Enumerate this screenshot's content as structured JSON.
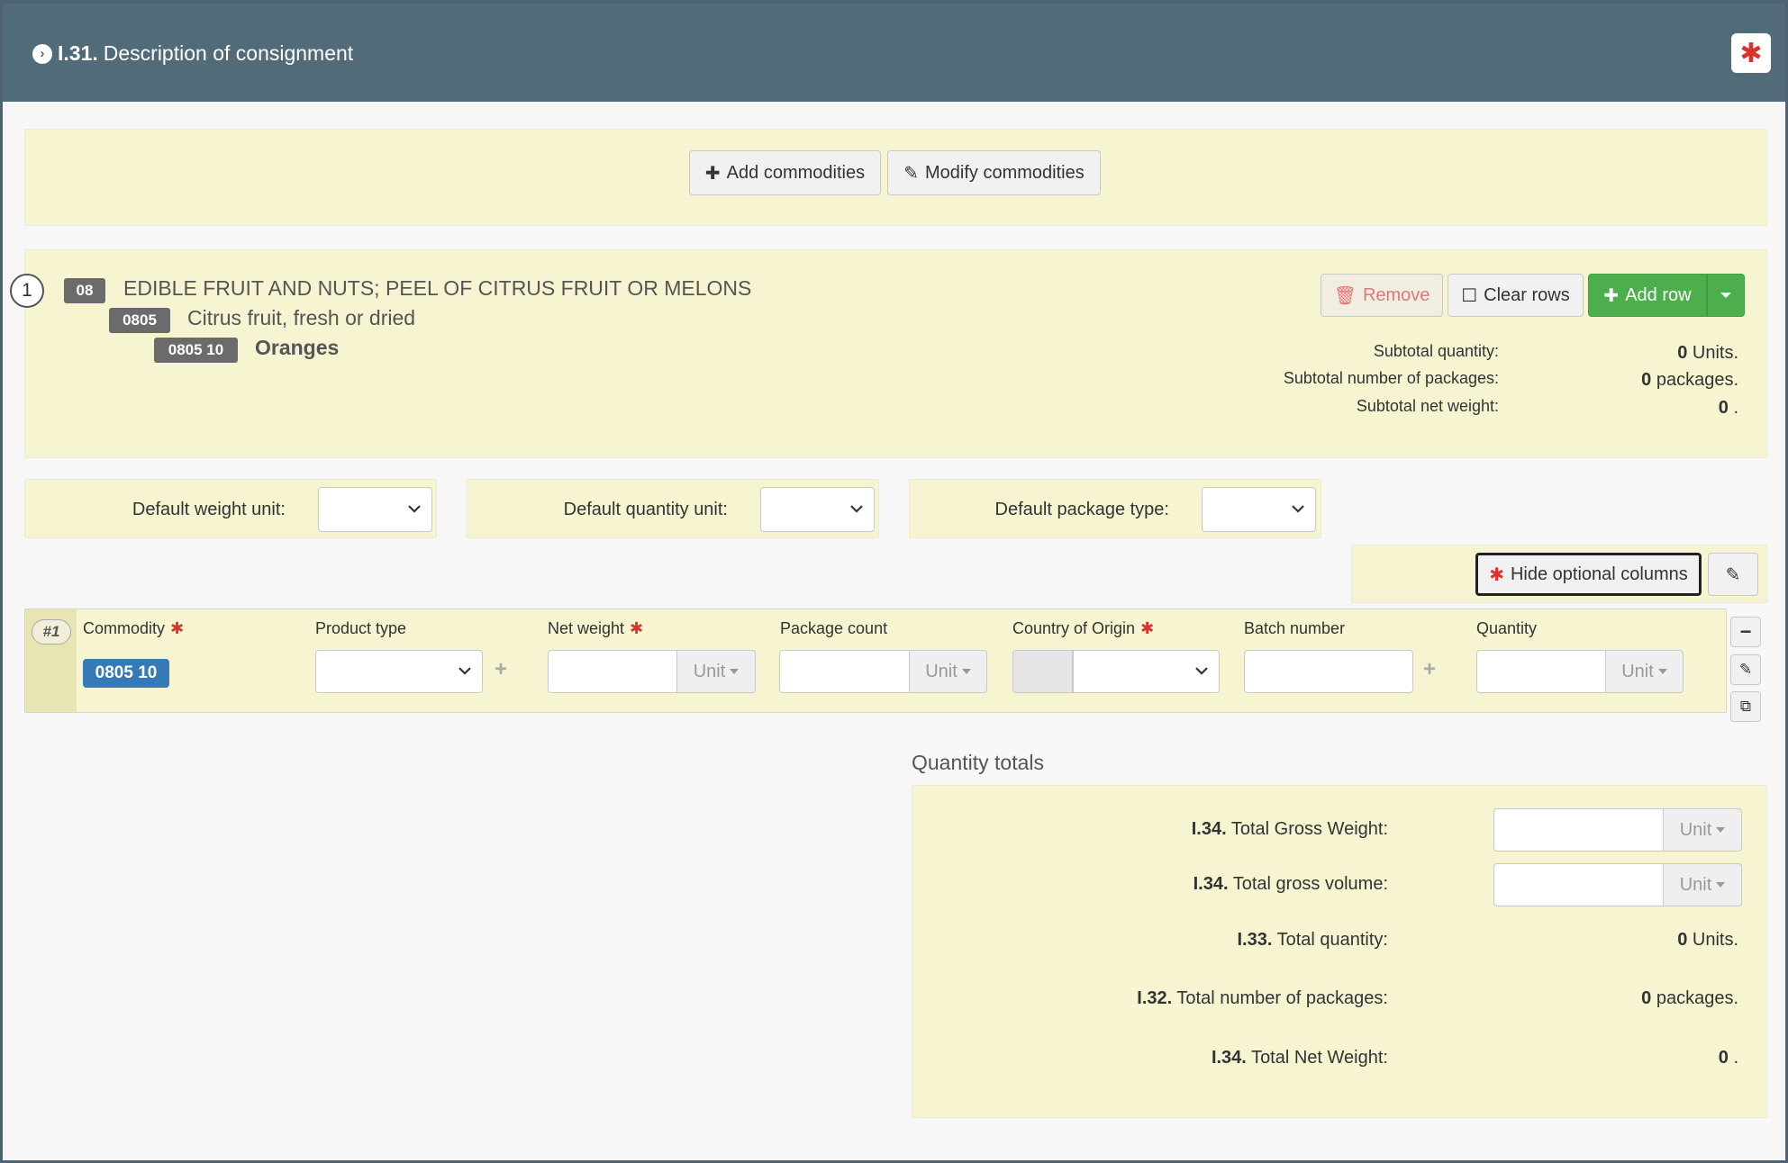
{
  "header": {
    "section_number": "I.31.",
    "title": "Description of consignment",
    "star_glyph": "✱"
  },
  "toolbar": {
    "add_commodities": "Add commodities",
    "modify_commodities": "Modify commodities"
  },
  "commodity_group": {
    "index": "1",
    "chapter_code": "08",
    "chapter_name": "EDIBLE FRUIT AND NUTS; PEEL OF CITRUS FRUIT OR MELONS",
    "heading_code": "0805",
    "heading_name": "Citrus fruit, fresh or dried",
    "sub_code": "0805 10",
    "sub_name": "Oranges",
    "remove_label": "Remove",
    "clear_rows_label": "Clear rows",
    "add_row_label": "Add row",
    "subtotals": [
      {
        "label": "Subtotal quantity:",
        "value": "0",
        "unit": "Units."
      },
      {
        "label": "Subtotal number of packages:",
        "value": "0",
        "unit": "packages."
      },
      {
        "label": "Subtotal net weight:",
        "value": "0",
        "unit": "."
      }
    ]
  },
  "defaults": {
    "weight_unit_label": "Default weight unit:",
    "quantity_unit_label": "Default quantity unit:",
    "package_type_label": "Default package type:"
  },
  "optional": {
    "hide_label": "Hide optional columns"
  },
  "table": {
    "columns": [
      "Commodity",
      "Product type",
      "Net weight",
      "Package count",
      "Country of Origin",
      "Batch number",
      "Quantity"
    ],
    "row_index": "#1",
    "commodity_code": "0805 10",
    "unit_label": "Unit"
  },
  "totals": {
    "heading": "Quantity totals",
    "rows": [
      {
        "code": "I.34.",
        "label": "Total Gross Weight:",
        "unit": "Unit"
      },
      {
        "code": "I.34.",
        "label": "Total gross volume:",
        "unit": "Unit"
      },
      {
        "code": "I.33.",
        "label": "Total quantity:",
        "value": "0",
        "suffix": "Units."
      },
      {
        "code": "I.32.",
        "label": "Total number of packages:",
        "value": "0",
        "suffix": "packages."
      },
      {
        "code": "I.34.",
        "label": "Total Net Weight:",
        "value": "0",
        "suffix": "."
      }
    ]
  },
  "colors": {
    "header_bg": "#526b79",
    "panel_bg": "#f6f4d1",
    "primary": "#337ab7",
    "success": "#4cae4c",
    "danger": "#d9332c"
  }
}
